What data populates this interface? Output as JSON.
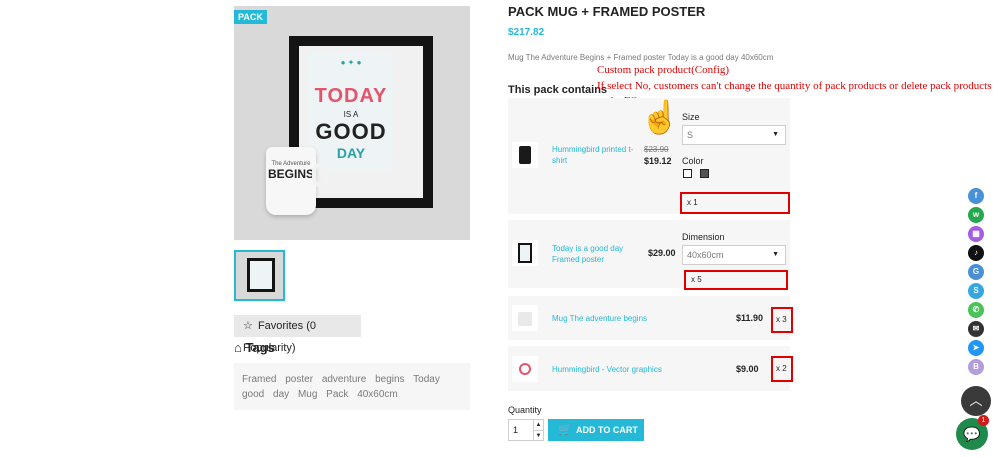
{
  "gallery": {
    "badge": "PACK",
    "artwork_text": {
      "line1": "TODAY",
      "line2": "IS A",
      "line3": "GOOD",
      "line4": "DAY"
    },
    "mug_text": {
      "top": "The Adventure",
      "bottom": "BEGINS"
    }
  },
  "favorites": {
    "label": "Favorites (0 Popularity)"
  },
  "tags": {
    "title": "Tags",
    "items": [
      "Framed",
      "poster",
      "adventure",
      "begins",
      "Today",
      "good",
      "day",
      "Mug",
      "Pack",
      "40x60cm"
    ]
  },
  "product": {
    "title": "PACK MUG + FRAMED POSTER",
    "price": "$217.82",
    "description": "Mug The Adventure Begins + Framed poster Today is a good day 40x60cm"
  },
  "pack": {
    "heading": "This pack contains",
    "items": [
      {
        "name": "Hummingbird printed t-shirt",
        "old_price": "$23.90",
        "price": "$19.12",
        "qty": "x 1",
        "size_label": "Size",
        "size_value": "S",
        "color_label": "Color"
      },
      {
        "name": "Today is a good day Framed poster",
        "price": "$29.00",
        "qty": "x 5",
        "dimension_label": "Dimension",
        "dimension_value": "40x60cm"
      },
      {
        "name": "Mug The adventure begins",
        "price": "$11.90",
        "qty": "x 3"
      },
      {
        "name": "Hummingbird - Vector graphics",
        "price": "$9.00",
        "qty": "x 2"
      }
    ]
  },
  "annotation": {
    "line1": "Custom pack product(Config)",
    "line2": "If select No, customers can't change the quantity of pack products or delete pack products at the FO.",
    "color": "#e00000"
  },
  "cart": {
    "quantity_label": "Quantity",
    "quantity_value": "1",
    "add_label": "ADD TO CART"
  },
  "social": {
    "icons": [
      {
        "name": "facebook-icon",
        "color": "#4a90d9",
        "glyph": "f"
      },
      {
        "name": "whatsapp-icon",
        "color": "#25a94f",
        "glyph": "w"
      },
      {
        "name": "grid-icon",
        "color": "#a45ce0",
        "glyph": "▦"
      },
      {
        "name": "tiktok-icon",
        "color": "#111111",
        "glyph": "♪"
      },
      {
        "name": "google-icon",
        "color": "#4a90d9",
        "glyph": "G"
      },
      {
        "name": "skype-icon",
        "color": "#35a7e0",
        "glyph": "S"
      },
      {
        "name": "phone-icon",
        "color": "#4cc25b",
        "glyph": "✆"
      },
      {
        "name": "email-icon",
        "color": "#333333",
        "glyph": "✉"
      },
      {
        "name": "messenger-icon",
        "color": "#2196f3",
        "glyph": "➤"
      },
      {
        "name": "b-icon",
        "color": "#b39ddb",
        "glyph": "B"
      }
    ]
  },
  "chat": {
    "badge_count": "1"
  },
  "colors": {
    "accent": "#24b9d7",
    "annotation_red": "#e00000"
  }
}
